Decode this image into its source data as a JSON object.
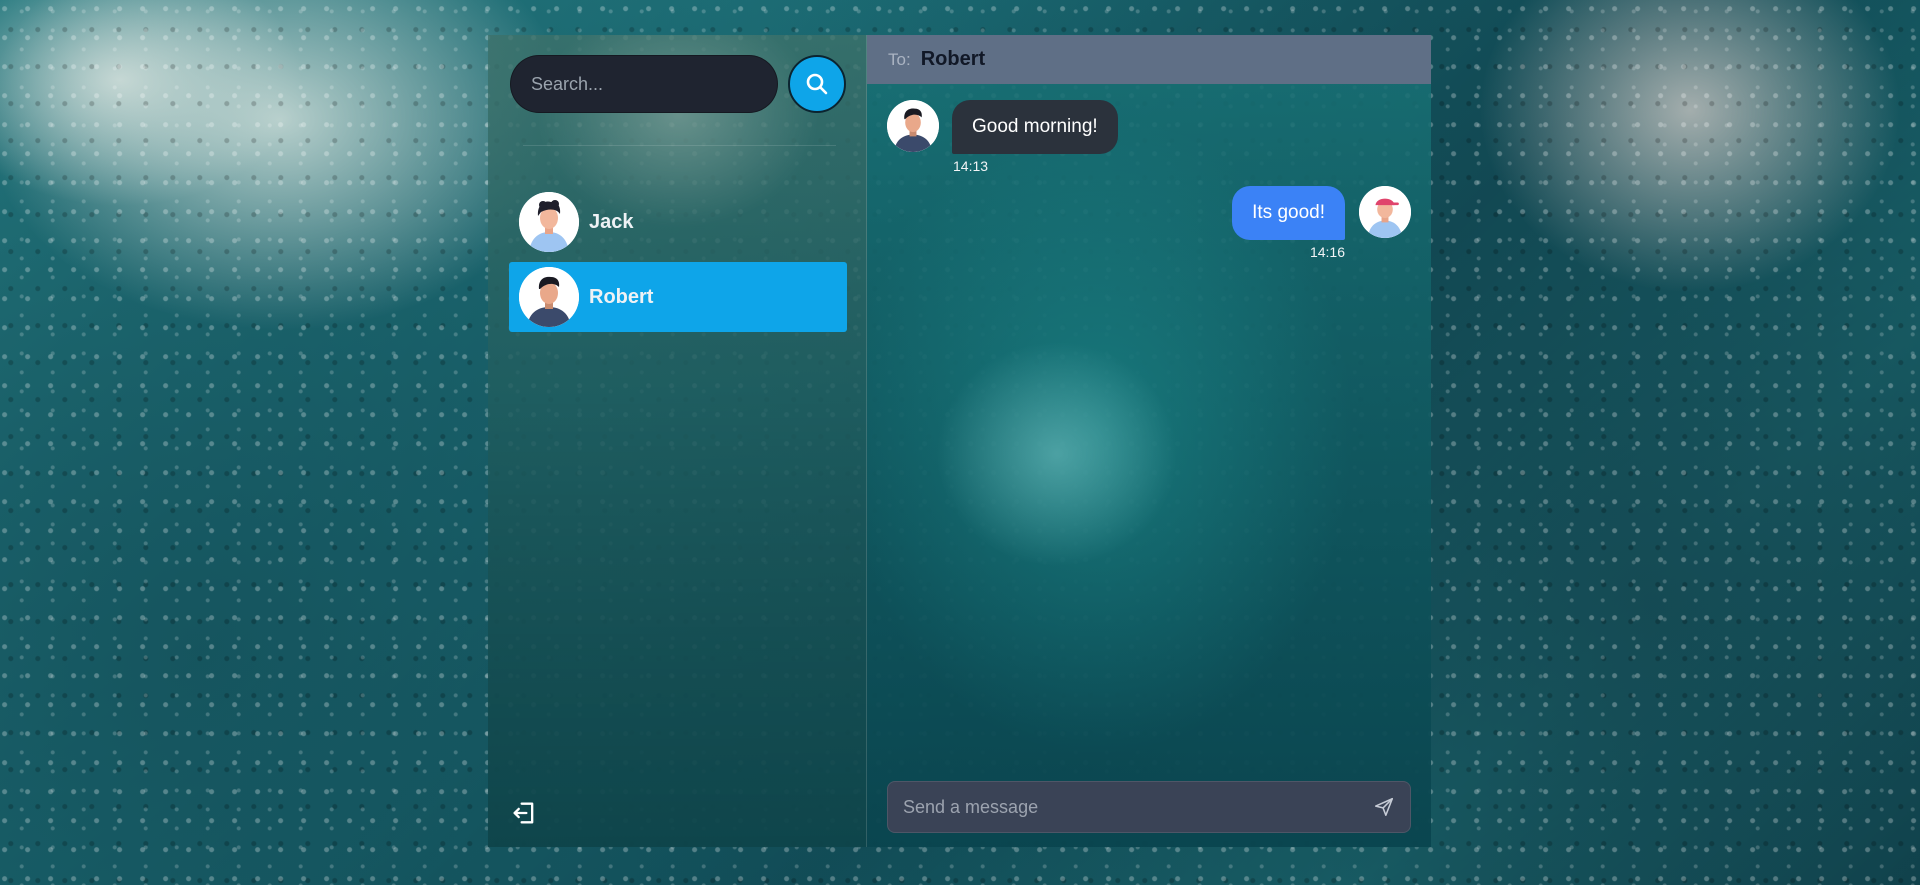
{
  "colors": {
    "accent": "#0ea5e9",
    "outgoing_bubble": "#3b82f6",
    "incoming_bubble": "#2b323c",
    "header_bg": "#5f6f86"
  },
  "sidebar": {
    "search": {
      "placeholder": "Search...",
      "value": "",
      "button_icon": "search-icon"
    },
    "contacts": [
      {
        "name": "Jack",
        "avatar_icon": "avatar-jack",
        "active": false
      },
      {
        "name": "Robert",
        "avatar_icon": "avatar-robert",
        "active": true
      }
    ],
    "logout_icon": "logout-icon"
  },
  "chat": {
    "header": {
      "to_label": "To:",
      "recipient": "Robert"
    },
    "messages": [
      {
        "direction": "incoming",
        "text": "Good morning!",
        "time": "14:13"
      },
      {
        "direction": "outgoing",
        "text": "Its good!",
        "time": "14:16"
      }
    ],
    "composer": {
      "placeholder": "Send a message",
      "value": "",
      "send_icon": "send-icon"
    }
  }
}
